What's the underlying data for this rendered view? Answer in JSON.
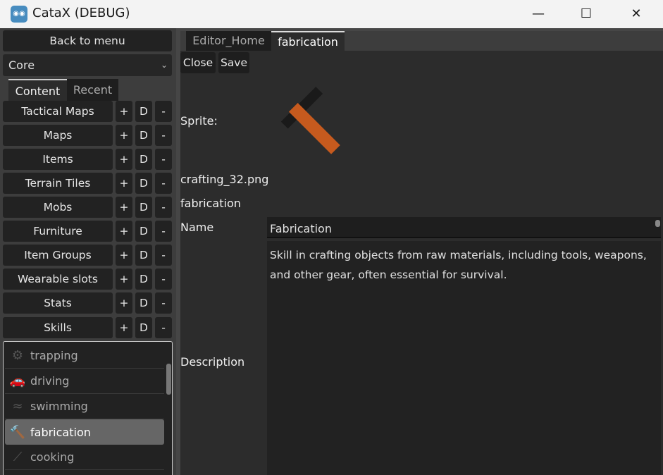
{
  "window": {
    "title": "CataX (DEBUG)",
    "minimize": "—",
    "maximize": "☐",
    "close": "✕",
    "icon": "godot-icon"
  },
  "sidebar": {
    "back_label": "Back to menu",
    "dropdown_value": "Core",
    "tabs": [
      {
        "label": "Content",
        "selected": true
      },
      {
        "label": "Recent",
        "selected": false
      }
    ],
    "add": "+",
    "dup": "D",
    "remove": "-",
    "categories": [
      "Tactical Maps",
      "Maps",
      "Items",
      "Terrain Tiles",
      "Mobs",
      "Furniture",
      "Item Groups",
      "Wearable slots",
      "Stats",
      "Skills"
    ],
    "list": [
      {
        "label": "trapping",
        "icon": "trap-icon"
      },
      {
        "label": "driving",
        "icon": "car-icon"
      },
      {
        "label": "swimming",
        "icon": "swimmer-icon"
      },
      {
        "label": "fabrication",
        "icon": "hammer-icon",
        "selected": true
      },
      {
        "label": "cooking",
        "icon": "spatula-icon"
      }
    ]
  },
  "editor": {
    "tabs": [
      {
        "label": "Editor_Home"
      },
      {
        "label": "fabrication",
        "selected": true
      }
    ],
    "close_label": "Close",
    "save_label": "Save",
    "sprite_label": "Sprite:",
    "sprite_file": "crafting_32.png",
    "id": "fabrication",
    "name_label": "Name",
    "name_value": "Fabrication",
    "description_label": "Description",
    "description_value": "Skill in crafting objects from raw materials, including tools, weapons, and other gear, often essential for survival."
  },
  "colors": {
    "accent": "#c65a1e",
    "selected": "#666666"
  }
}
